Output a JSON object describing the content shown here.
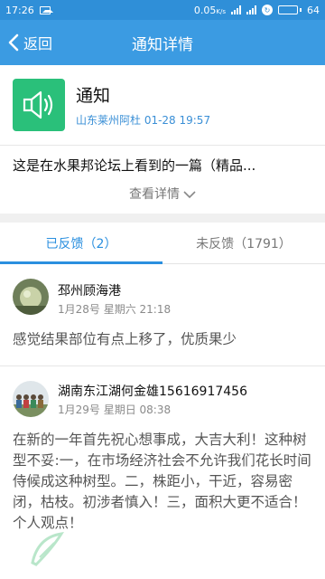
{
  "status_bar": {
    "time": "17:26",
    "network_speed": "0.05",
    "network_speed_unit": "K/s",
    "battery": "64",
    "battery_level": 0.64
  },
  "nav": {
    "back_label": "返回",
    "title": "通知详情"
  },
  "notice": {
    "icon": "speaker-icon",
    "title": "通知",
    "meta": "山东莱州阿杜 01-28 19:57",
    "summary": "这是在水果邦论坛上看到的一篇（精品...",
    "view_detail": "查看详情"
  },
  "tabs": [
    {
      "label": "已反馈（2）",
      "active": true
    },
    {
      "label": "未反馈（1791）",
      "active": false
    }
  ],
  "replies": [
    {
      "name": "邳州顾海港",
      "time": "1月28号 星期六 21:18",
      "body": "感觉结果部位有点上移了，优质果少"
    },
    {
      "name": "湖南东江湖何金雄15616917456",
      "time": "1月29号 星期日 08:38",
      "body": "在新的一年首先祝心想事成，大吉大利！这种树型不妥:一，在市场经济社会不允许我们花长时间侍候成这种树型。二，株距小，干近，容易密闭，枯枝。初涉者慎入！三，面积大更不适合！个人观点！"
    }
  ],
  "colors": {
    "status_bar": "#2f8fd8",
    "nav_bar": "#3b9be2",
    "accent": "#2a8fdf",
    "notice_icon_bg": "#2ac07a"
  }
}
